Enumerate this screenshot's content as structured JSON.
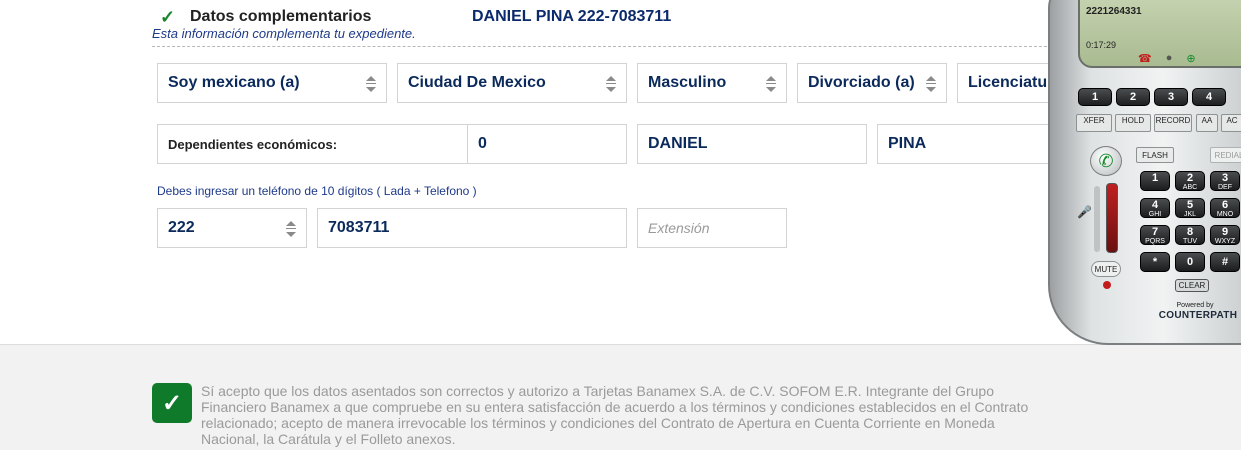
{
  "section": {
    "title": "Datos complementarios",
    "client_name": "DANIEL PINA 222-7083711",
    "subtitle": "Esta información complementa tu expediente."
  },
  "row1": {
    "nationality": "Soy mexicano (a)",
    "city": "Ciudad De Mexico",
    "gender": "Masculino",
    "marital_status": "Divorciado (a)",
    "education": "Licenciatura"
  },
  "row2": {
    "dependents_label": "Dependientes económicos:",
    "dependents_value": "0",
    "first_name": "DANIEL",
    "last_name": "PINA"
  },
  "phone": {
    "hint": "Debes ingresar un teléfono de 10 dígitos ( Lada + Telefono )",
    "lada": "222",
    "number": "7083711",
    "extension_placeholder": "Extensión"
  },
  "footer": {
    "accept_text": "Sí acepto que los datos asentados son correctos y autorizo a Tarjetas Banamex S.A. de C.V. SOFOM E.R. Integrante del Grupo Financiero Banamex a que compruebe en su entera satisfacción de acuerdo a los términos y condiciones establecidos en el Contrato relacionado; acepto de manera irrevocable los términos y condiciones del Contrato de Apertura en Cuenta Corriente en Moneda Nacional, la Carátula y el Folleto anexos."
  },
  "softphone": {
    "screen_number": "2221264331",
    "call_time": "0:17:29",
    "line_buttons": [
      "1",
      "2",
      "3",
      "4"
    ],
    "func_buttons": [
      "XFER",
      "HOLD",
      "RECORD",
      "AA",
      "AC"
    ],
    "flash_label": "FLASH",
    "redial_label": "REDIAL",
    "mute_label": "MUTE",
    "clear_label": "CLEAR",
    "powered_by": "Powered by",
    "brand": "COUNTERPATH",
    "keys": [
      {
        "digit": "1",
        "letters": ""
      },
      {
        "digit": "2",
        "letters": "ABC"
      },
      {
        "digit": "3",
        "letters": "DEF"
      },
      {
        "digit": "4",
        "letters": "GHI"
      },
      {
        "digit": "5",
        "letters": "JKL"
      },
      {
        "digit": "6",
        "letters": "MNO"
      },
      {
        "digit": "7",
        "letters": "PQRS"
      },
      {
        "digit": "8",
        "letters": "TUV"
      },
      {
        "digit": "9",
        "letters": "WXYZ"
      },
      {
        "digit": "*",
        "letters": ""
      },
      {
        "digit": "0",
        "letters": ""
      },
      {
        "digit": "#",
        "letters": ""
      }
    ]
  }
}
